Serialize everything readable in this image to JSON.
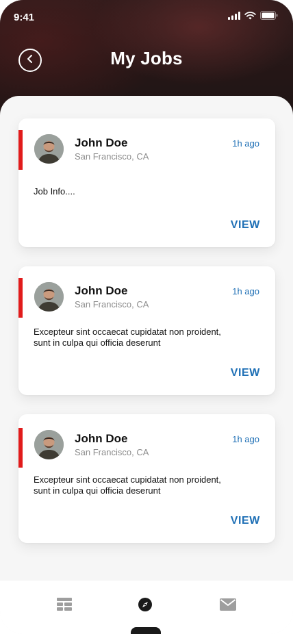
{
  "status_bar": {
    "time": "9:41",
    "icons": [
      "signal-icon",
      "wifi-icon",
      "battery-icon"
    ]
  },
  "header": {
    "title": "My Jobs",
    "back_icon": "chevron-left-icon"
  },
  "jobs": [
    {
      "name": "John Doe",
      "location": "San Francisco, CA",
      "time_ago": "1h ago",
      "info": "Job Info....",
      "action": "VIEW"
    },
    {
      "name": "John Doe",
      "location": "San Francisco, CA",
      "time_ago": "1h ago",
      "info": "Excepteur sint occaecat cupidatat non proident, sunt in culpa qui officia deserunt",
      "action": "VIEW"
    },
    {
      "name": "John Doe",
      "location": "San Francisco, CA",
      "time_ago": "1h ago",
      "info": "Excepteur sint occaecat cupidatat non proident, sunt in culpa qui officia deserunt",
      "action": "VIEW"
    }
  ],
  "tab_bar": {
    "tabs": [
      {
        "icon": "list-icon",
        "active": false
      },
      {
        "icon": "compass-icon",
        "active": true
      },
      {
        "icon": "mail-icon",
        "active": false
      }
    ]
  },
  "colors": {
    "accent_red": "#e11b1b",
    "link_blue": "#1e6fb5",
    "header_dark": "#241616"
  }
}
